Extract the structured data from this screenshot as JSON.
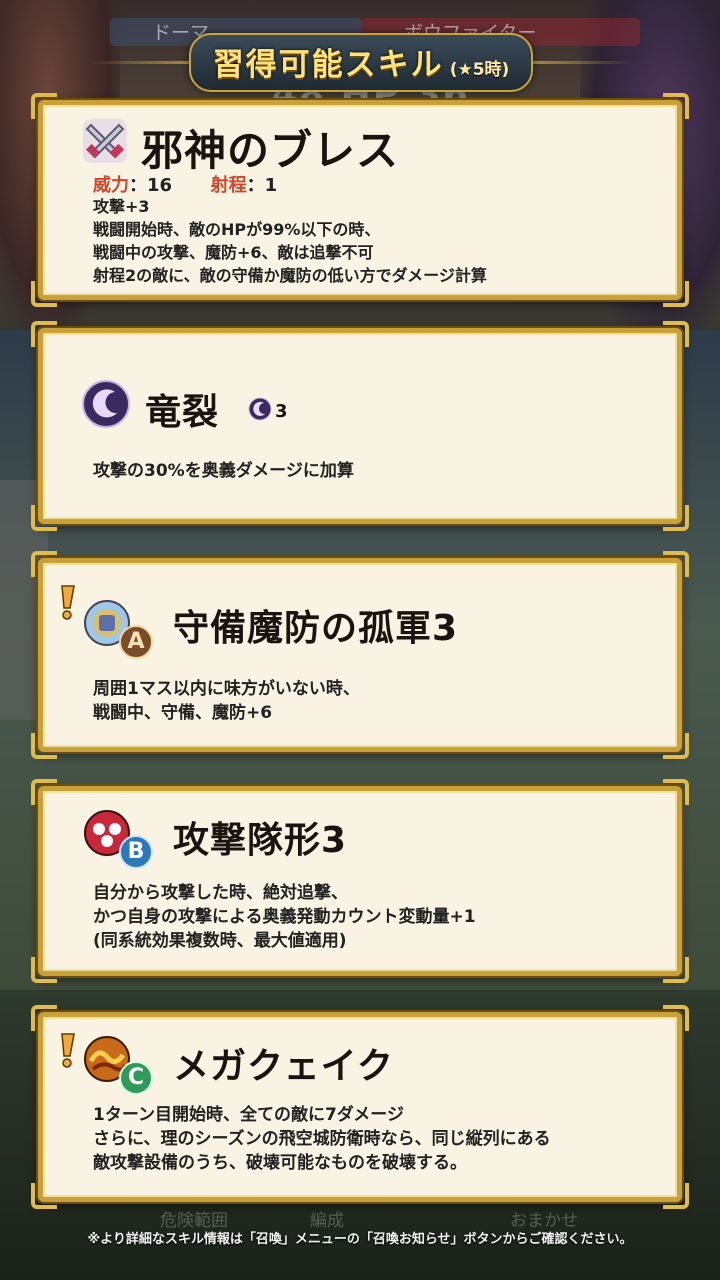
{
  "background": {
    "hero_left": "ドーマ",
    "hero_right": "ボウファイター",
    "hp_ghost": "48 HP 36",
    "bottom_left": "危険範囲",
    "bottom_mid": "編成",
    "bottom_right": "おまかせ"
  },
  "header": {
    "title": "習得可能スキル",
    "subtitle": "(★5時)"
  },
  "skills": [
    {
      "name": "邪神のブレス",
      "icon": "weapon-icon",
      "stats": {
        "might_label": "威力",
        "might": "16",
        "range_label": "射程",
        "range": "1"
      },
      "lines": [
        "攻撃+3",
        "戦闘開始時、敵のHPが99%以下の時、",
        "戦闘中の攻撃、魔防+6、敵は追撃不可",
        "射程2の敵に、敵の守備か魔防の低い方でダメージ計算"
      ]
    },
    {
      "name": "竜裂",
      "icon": "special-icon",
      "cooldown": "3",
      "lines": [
        "攻撃の30%を奥義ダメージに加算"
      ]
    },
    {
      "name": "守備魔防の孤軍3",
      "icon": "passive-a-icon",
      "slot": "A",
      "lines": [
        "周囲1マス以内に味方がいない時、",
        "戦闘中、守備、魔防+6"
      ]
    },
    {
      "name": "攻撃隊形3",
      "icon": "passive-b-icon",
      "slot": "B",
      "lines": [
        "自分から攻撃した時、絶対追撃、",
        "かつ自身の攻撃による奥義発動カウント変動量+1",
        "(同系統効果複数時、最大値適用)"
      ]
    },
    {
      "name": "メガクェイク",
      "icon": "passive-c-icon",
      "slot": "C",
      "lines": [
        "1ターン目開始時、全ての敵に7ダメージ",
        "さらに、理のシーズンの飛空城防衛時なら、同じ縦列にある",
        "敵攻撃設備のうち、破壊可能なものを破壊する。"
      ]
    }
  ],
  "footer": "※より詳細なスキル情報は「召喚」メニューの「召喚お知らせ」ボタンからご確認ください。",
  "colors": {
    "frame_gold": "#c9a13a",
    "card_bg": "#f8f3e3",
    "stat_label": "#d3442a",
    "title_gold": "#ffe27a"
  }
}
